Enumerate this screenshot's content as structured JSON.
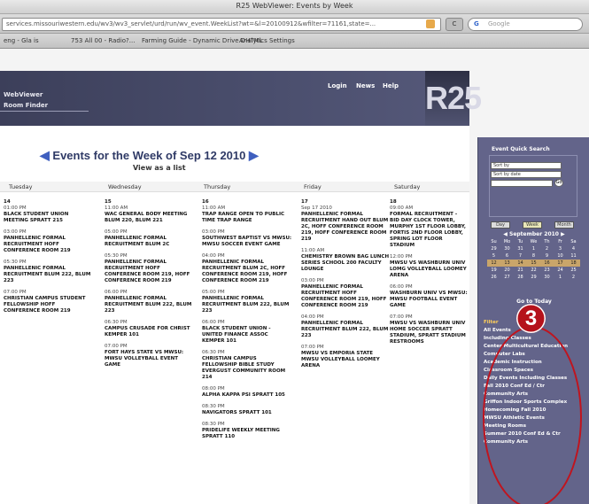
{
  "window": {
    "title": "R25 WebViewer: Events by Week"
  },
  "browser": {
    "url": "services.missouriwestern.edu/wv3/wv3_servlet/urd/run/wv_event.WeekList?wt=&l=20100912&wfilter=71161,state=...",
    "search_placeholder": "Google",
    "search_g": "G",
    "go_label": "C",
    "bookmarks": [
      "eng - Gla is",
      "753 All 00 - Radio?...",
      "Farming Guide - Dynamic Drive DHTML",
      "Analytics Settings"
    ]
  },
  "header": {
    "brand1": "WebViewer",
    "brand2": "Room Finder",
    "nav": [
      "Login",
      "News",
      "Help"
    ],
    "logo": "R25"
  },
  "calendar": {
    "heading": "Events for the Week of Sep 12 2010",
    "view_as_list": "View as a list",
    "days": [
      "Tuesday",
      "Wednesday",
      "Thursday",
      "Friday",
      "Saturday"
    ],
    "columns": [
      {
        "date": "14",
        "events": [
          {
            "time": "01:00 PM",
            "name": "BLACK STUDENT UNION MEETING SPRATT 215"
          },
          {
            "time": "03:00 PM",
            "name": "PANHELLENIC FORMAL RECRUITMENT HOFF CONFERENCE ROOM 219"
          },
          {
            "time": "05:30 PM",
            "name": "PANHELLENIC FORMAL RECRUITMENT BLUM 222, BLUM 223"
          },
          {
            "time": "07:00 PM",
            "name": "CHRISTIAN CAMPUS STUDENT FELLOWSHIP HOFF CONFERENCE ROOM 219"
          }
        ]
      },
      {
        "date": "15",
        "events": [
          {
            "time": "11:00 AM",
            "name": "WAC GENERAL BODY MEETING BLUM 220, BLUM 221"
          },
          {
            "time": "05:00 PM",
            "name": "PANHELLENIC FORMAL RECRUITMENT BLUM 2C"
          },
          {
            "time": "05:30 PM",
            "name": "PANHELLENIC FORMAL RECRUITMENT HOFF CONFERENCE ROOM 219, HOFF CONFERENCE ROOM 219"
          },
          {
            "time": "06:00 PM",
            "name": "PANHELLENIC FORMAL RECRUITMENT BLUM 222, BLUM 223"
          },
          {
            "time": "06:30 PM",
            "name": "CAMPUS CRUSADE FOR CHRIST KEMPER 101"
          },
          {
            "time": "07:00 PM",
            "name": "FORT HAYS STATE VS MWSU: MWSU VOLLEYBALL EVENT GAME"
          }
        ]
      },
      {
        "date": "16",
        "events": [
          {
            "time": "11:00 AM",
            "name": "TRAP RANGE OPEN TO PUBLIC TIME TRAP RANGE"
          },
          {
            "time": "03:00 PM",
            "name": "SOUTHWEST BAPTIST VS MWSU: MWSU SOCCER EVENT GAME"
          },
          {
            "time": "04:00 PM",
            "name": "PANHELLENIC FORMAL RECRUITMENT BLUM 2C, HOFF CONFERENCE ROOM 219, HOFF CONFERENCE ROOM 219"
          },
          {
            "time": "05:00 PM",
            "name": "PANHELLENIC FORMAL RECRUITMENT BLUM 222, BLUM 223"
          },
          {
            "time": "06:00 PM",
            "name": "BLACK STUDENT UNION - UNITED FINANCE ASSOC KEMPER 101"
          },
          {
            "time": "06:30 PM",
            "name": "CHRISTIAN CAMPUS FELLOWSHIP BIBLE STUDY EVERGUST COMMUNITY ROOM 214"
          },
          {
            "time": "08:00 PM",
            "name": "ALPHA KAPPA PSI SPRATT 105"
          },
          {
            "time": "08:30 PM",
            "name": "NAVIGATORS SPRATT 101"
          },
          {
            "time": "08:30 PM",
            "name": "PRIDELIFE WEEKLY MEETING SPRATT 110"
          }
        ]
      },
      {
        "date": "17",
        "events": [
          {
            "time": "Sep 17 2010",
            "name": "PANHELLENIC FORMAL RECRUITMENT HAND OUT BLUM 2C, HOFF CONFERENCE ROOM 219, HOFF CONFERENCE ROOM 219"
          },
          {
            "time": "11:00 AM",
            "name": "CHEMISTRY BROWN BAG LUNCH SERIES SCHOOL 200 FACULTY LOUNGE"
          },
          {
            "time": "03:00 PM",
            "name": "PANHELLENIC FORMAL RECRUITMENT HOFF CONFERENCE ROOM 219, HOFF CONFERENCE ROOM 219"
          },
          {
            "time": "04:00 PM",
            "name": "PANHELLENIC FORMAL RECRUITMENT BLUM 222, BLUM 223"
          },
          {
            "time": "07:00 PM",
            "name": "MWSU VS EMPORIA STATE MWSU VOLLEYBALL LOOMEY ARENA"
          }
        ]
      },
      {
        "date": "18",
        "events": [
          {
            "time": "09:00 AM",
            "name": "FORMAL RECRUITMENT - BID DAY CLOCK TOWER, MURPHY 1ST FLOOR LOBBY, FORTIS 2ND FLOOR LOBBY, SPRING LOT FLOOR STADIUM"
          },
          {
            "time": "12:00 PM",
            "name": "MWSU VS WASHBURN UNIV LOMG VOLLEYBALL LOOMEY ARENA"
          },
          {
            "time": "06:00 PM",
            "name": "WASHBURN UNIV VS MWSU: MWSU FOOTBALL EVENT GAME"
          },
          {
            "time": "07:00 PM",
            "name": "MWSU VS WASHBURN UNIV HOME SOCCER SPRATT STADIUM, SPRATT STADIUM RESTROOMS"
          }
        ]
      }
    ]
  },
  "sidebar": {
    "quick_search": "Event Quick Search",
    "select1": "Sort by",
    "select2": "Sort by date",
    "go": "Go",
    "toggles": [
      "Day",
      "Week",
      "Month"
    ],
    "month": "September 2010",
    "weekdays": [
      "Su",
      "Mo",
      "Tu",
      "We",
      "Th",
      "Fr",
      "Sa"
    ],
    "weeks": [
      [
        "29",
        "30",
        "31",
        "1",
        "2",
        "3",
        "4"
      ],
      [
        "5",
        "6",
        "7",
        "8",
        "9",
        "10",
        "11"
      ],
      [
        "12",
        "13",
        "14",
        "15",
        "16",
        "17",
        "18"
      ],
      [
        "19",
        "20",
        "21",
        "22",
        "23",
        "24",
        "25"
      ],
      [
        "26",
        "27",
        "28",
        "29",
        "30",
        "1",
        "2"
      ]
    ],
    "go_today": "Go to Today",
    "filter_heading": "Filter",
    "filters": [
      "All Events",
      "Including Classes",
      "Center Multicultural Education",
      "Computer Labs",
      "Academic Instruction",
      "Classroom Spaces",
      "Daily Events Including Classes",
      "Fall 2010 Conf Ed / Ctr",
      "Community Arts",
      "Griffon Indoor Sports Complex",
      "Homecoming Fall 2010",
      "MWSU Athletic Events",
      "Meeting Rooms",
      "Summer 2010 Conf Ed & Ctr Community Arts"
    ]
  },
  "annotation": {
    "number": "3",
    "color": "#b5121b"
  }
}
